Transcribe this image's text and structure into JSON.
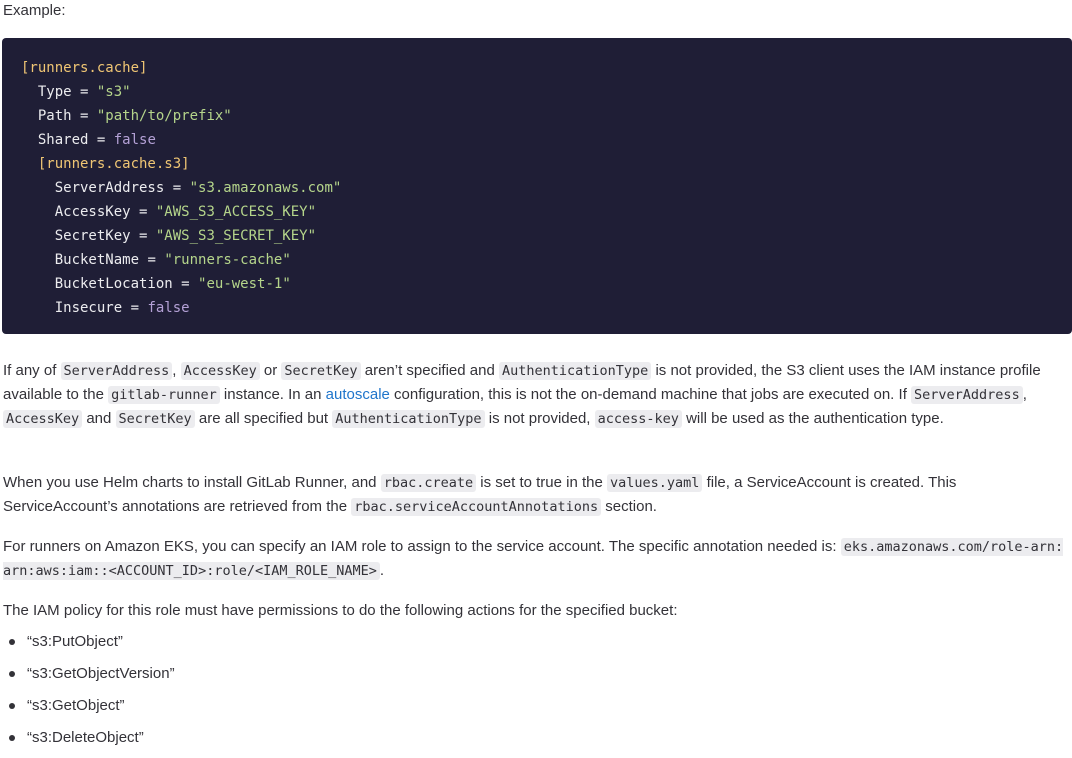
{
  "intro": {
    "label": "Example:"
  },
  "code_block": {
    "lines": [
      {
        "indent": "",
        "tokens": [
          {
            "type": "section",
            "text": "[runners.cache]"
          }
        ]
      },
      {
        "indent": "  ",
        "tokens": [
          {
            "type": "key",
            "text": "Type"
          },
          {
            "type": "eq",
            "text": " = "
          },
          {
            "type": "string",
            "text": "\"s3\""
          }
        ]
      },
      {
        "indent": "  ",
        "tokens": [
          {
            "type": "key",
            "text": "Path"
          },
          {
            "type": "eq",
            "text": " = "
          },
          {
            "type": "string",
            "text": "\"path/to/prefix\""
          }
        ]
      },
      {
        "indent": "  ",
        "tokens": [
          {
            "type": "key",
            "text": "Shared"
          },
          {
            "type": "eq",
            "text": " = "
          },
          {
            "type": "bool",
            "text": "false"
          }
        ]
      },
      {
        "indent": "  ",
        "tokens": [
          {
            "type": "section",
            "text": "[runners.cache.s3]"
          }
        ]
      },
      {
        "indent": "    ",
        "tokens": [
          {
            "type": "key",
            "text": "ServerAddress"
          },
          {
            "type": "eq",
            "text": " = "
          },
          {
            "type": "string",
            "text": "\"s3.amazonaws.com\""
          }
        ]
      },
      {
        "indent": "    ",
        "tokens": [
          {
            "type": "key",
            "text": "AccessKey"
          },
          {
            "type": "eq",
            "text": " = "
          },
          {
            "type": "string",
            "text": "\"AWS_S3_ACCESS_KEY\""
          }
        ]
      },
      {
        "indent": "    ",
        "tokens": [
          {
            "type": "key",
            "text": "SecretKey"
          },
          {
            "type": "eq",
            "text": " = "
          },
          {
            "type": "string",
            "text": "\"AWS_S3_SECRET_KEY\""
          }
        ]
      },
      {
        "indent": "    ",
        "tokens": [
          {
            "type": "key",
            "text": "BucketName"
          },
          {
            "type": "eq",
            "text": " = "
          },
          {
            "type": "string",
            "text": "\"runners-cache\""
          }
        ]
      },
      {
        "indent": "    ",
        "tokens": [
          {
            "type": "key",
            "text": "BucketLocation"
          },
          {
            "type": "eq",
            "text": " = "
          },
          {
            "type": "string",
            "text": "\"eu-west-1\""
          }
        ]
      },
      {
        "indent": "    ",
        "tokens": [
          {
            "type": "key",
            "text": "Insecure"
          },
          {
            "type": "eq",
            "text": " = "
          },
          {
            "type": "bool",
            "text": "false"
          }
        ]
      }
    ]
  },
  "paragraph1": {
    "t1": "If any of ",
    "c1": "ServerAddress",
    "t2": ", ",
    "c2": "AccessKey",
    "t3": " or ",
    "c3": "SecretKey",
    "t4": " aren’t specified and ",
    "c4": "AuthenticationType",
    "t5": " is not provided, the S3 client uses the IAM instance profile available to the ",
    "c5": "gitlab-runner",
    "t6": " instance. In an ",
    "link": "autoscale",
    "t7": " configuration, this is not the on-demand machine that jobs are executed on. If ",
    "c6": "ServerAddress",
    "t8": ", ",
    "c7": "AccessKey",
    "t9": " and ",
    "c8": "SecretKey",
    "t10": " are all specified but ",
    "c9": "AuthenticationType",
    "t11": " is not provided, ",
    "c10": "access-key",
    "t12": " will be used as the authentication type."
  },
  "paragraph2": {
    "t1": "When you use Helm charts to install GitLab Runner, and ",
    "c1": "rbac.create",
    "t2": " is set to true in the ",
    "c2": "values.yaml",
    "t3": " file, a ServiceAccount is created. This ServiceAccount’s annotations are retrieved from the ",
    "c3": "rbac.serviceAccountAnnotations",
    "t4": " section."
  },
  "paragraph3": {
    "t1": "For runners on Amazon EKS, you can specify an IAM role to assign to the service account. The specific annotation needed is: ",
    "c1": "eks.amazonaws.com/role-arn: arn:aws:iam::<ACCOUNT_ID>:role/<IAM_ROLE_NAME>",
    "t2": "."
  },
  "paragraph4": {
    "text": "The IAM policy for this role must have permissions to do the following actions for the specified bucket:"
  },
  "actions": [
    "“s3:PutObject”",
    "“s3:GetObjectVersion”",
    "“s3:GetObject”",
    "“s3:DeleteObject”"
  ]
}
